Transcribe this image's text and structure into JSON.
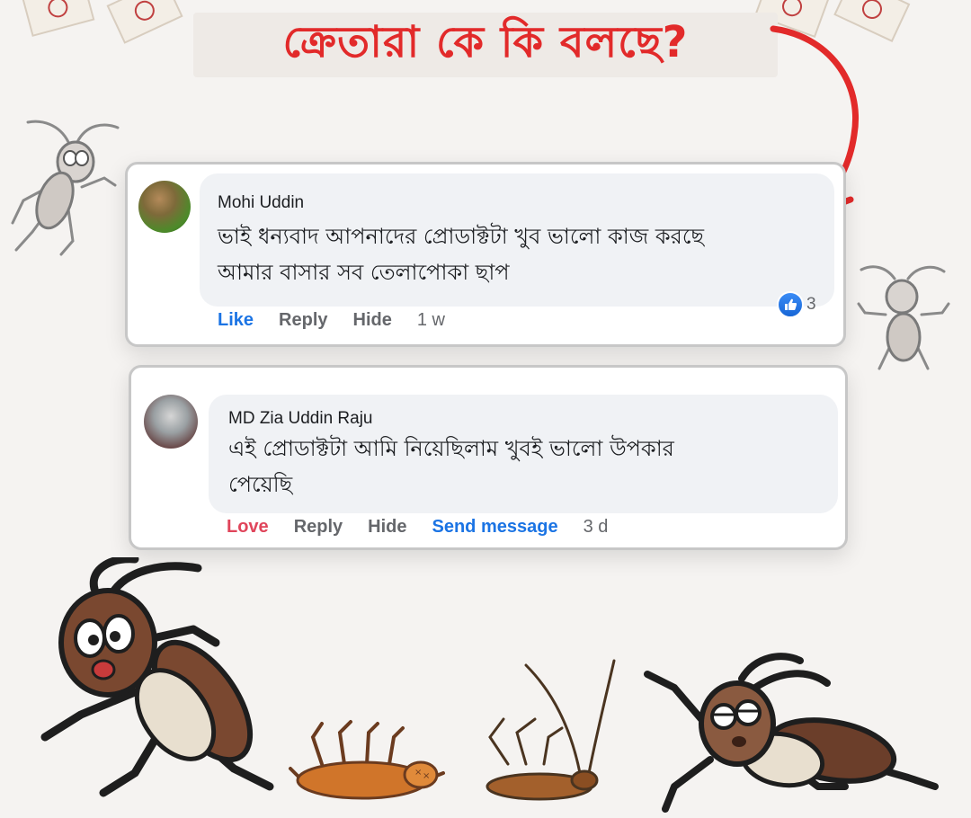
{
  "header": {
    "title": "ক্রেতারা কে কি বলছে?"
  },
  "colors": {
    "title": "#e22a2a",
    "arrow": "#e22a2a",
    "link_blue": "#1b74e4",
    "love_red": "#e0455b",
    "muted": "#65676b",
    "bubble": "#f0f2f5"
  },
  "comments": [
    {
      "author": "Mohi Uddin",
      "text_line1": "ভাই ধন্যবাদ আপনাদের প্রোডাক্টটা খুব ভালো কাজ করছে",
      "text_line2": "আমার বাসার সব তেলাপোকা ছাপ",
      "reaction_icon": "thumbs-up-icon",
      "reaction_count": "3",
      "actions": [
        "Like",
        "Reply",
        "Hide"
      ],
      "time": "1 w"
    },
    {
      "author": "MD Zia Uddin Raju",
      "text_line1": "এই প্রোডাক্টটা আমি নিয়েছিলাম খুবই ভালো উপকার",
      "text_line2": "পেয়েছি",
      "actions": [
        "Love",
        "Reply",
        "Hide",
        "Send message"
      ],
      "time": "3 d"
    }
  ],
  "decor": {
    "arrow_icon": "curved-arrow-icon",
    "illustrations": [
      "cockroach-icon",
      "dead-cockroach-icon",
      "product-packet-icon"
    ]
  }
}
